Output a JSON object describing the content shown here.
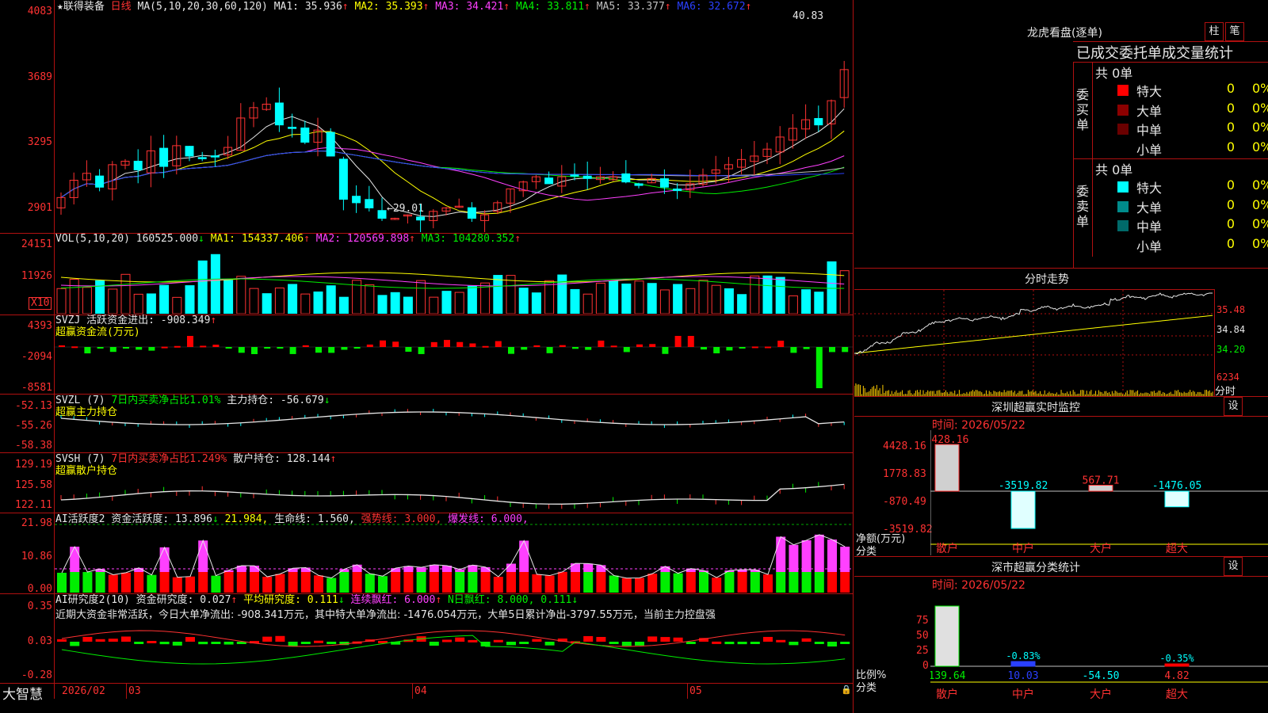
{
  "main": {
    "stock_name": "★联得装备",
    "period": "日线",
    "ma_header": "MA(5,10,20,30,60,120)",
    "ma_values": [
      {
        "label": "MA1:",
        "value": "35.936",
        "arrow": "↑",
        "color": "#e6e6e6"
      },
      {
        "label": "MA2:",
        "value": "35.393",
        "arrow": "↑",
        "color": "#ffff00"
      },
      {
        "label": "MA3:",
        "value": "34.421",
        "arrow": "↑",
        "color": "#ff40ff"
      },
      {
        "label": "MA4:",
        "value": "33.811",
        "arrow": "↑",
        "color": "#00ee00"
      },
      {
        "label": "MA5:",
        "value": "33.377",
        "arrow": "↑",
        "color": "#c0c0c0"
      },
      {
        "label": "MA6:",
        "value": "32.672",
        "arrow": "↑",
        "color": "#2a40ff"
      }
    ],
    "y_ticks": [
      "4083",
      "3689",
      "3295",
      "2901"
    ],
    "high_label": "40.83",
    "low_label": "←29.01"
  },
  "vol": {
    "header": "VOL(5,10,20)",
    "value": "160525.000",
    "value_arrow": "↓",
    "ma": [
      {
        "label": "MA1:",
        "value": "154337.406",
        "arrow": "↑",
        "color": "#ffff00"
      },
      {
        "label": "MA2:",
        "value": "120569.898",
        "arrow": "↑",
        "color": "#ff40ff"
      },
      {
        "label": "MA3:",
        "value": "104280.352",
        "arrow": "↑",
        "color": "#00ee00"
      }
    ],
    "y_ticks": [
      "24151",
      "11926"
    ],
    "unit": "X10"
  },
  "svzj": {
    "header": "SVZJ",
    "label": "活跃资金进出:",
    "value": "-908.349",
    "arrow": "↑",
    "subtitle": "超赢资金流(万元)",
    "y_ticks": [
      "4393",
      "-2094",
      "-8581"
    ]
  },
  "svzl": {
    "header": "SVZL (7)",
    "ratio": "7日内买卖净占比1.01%",
    "label": "主力持仓:",
    "value": "-56.679",
    "arrow": "↓",
    "subtitle": "超赢主力持仓",
    "y_ticks": [
      "-52.13",
      "-55.26",
      "-58.38"
    ]
  },
  "svsh": {
    "header": "SVSH (7)",
    "ratio": "7日内买卖净占比1.249%",
    "label": "散户持仓:",
    "value": "128.144",
    "arrow": "↑",
    "subtitle": "超赢散户持仓",
    "y_ticks": [
      "129.19",
      "125.58",
      "122.11"
    ]
  },
  "ai1": {
    "header": "AI活跃度2",
    "label": "资金活跃度:",
    "value": "13.896",
    "arrow": "↓",
    "v2": "21.984,",
    "life_label": "生命线:",
    "life_value": "1.560,",
    "strong": "强势线: 3.000,",
    "burst": "爆发线: 6.000,",
    "y_ticks": [
      "21.98",
      "10.86",
      "0.00"
    ]
  },
  "ai2": {
    "header": "AI研究度2(10)",
    "label": "资金研究度:",
    "value": "0.027",
    "arrow": "↑",
    "avg": "平均研究度: 0.111",
    "avg_arrow": "↓",
    "streak": "连续飘红: 6.000",
    "streak_arrow": "↑",
    "nday": "N日飘红: 8.000, 0.111",
    "nday_arrow": "↓",
    "commentary": "近期大资金非常活跃，今日大单净流出: -908.341万元，其中特大单净流出: -1476.054万元，大单5日累计净出-3797.55万元，当前主力控盘强",
    "y_ticks": [
      "0.35",
      "0.03",
      "-0.28"
    ]
  },
  "xaxis": {
    "brand": "大智慧",
    "labels": [
      "2026/02",
      "03",
      "04",
      "05"
    ]
  },
  "lhb": {
    "title": "龙虎看盘(逐单)",
    "btn_col": "柱",
    "btn_tick": "笔",
    "tabs": [
      "已成交",
      "委托单",
      "成交量统计"
    ],
    "buy": {
      "side": "委买单",
      "total": "共 0单",
      "rows": [
        {
          "label": "特大",
          "count": "0",
          "pct": "0%",
          "color": "#ff0000"
        },
        {
          "label": "大单",
          "count": "0",
          "pct": "0%",
          "color": "#8b0000"
        },
        {
          "label": "中单",
          "count": "0",
          "pct": "0%",
          "color": "#6a0000"
        },
        {
          "label": "小单",
          "count": "0",
          "pct": "0%",
          "color": "#000000"
        }
      ]
    },
    "sell": {
      "side": "委卖单",
      "total": "共 0单",
      "rows": [
        {
          "label": "特大",
          "count": "0",
          "pct": "0%",
          "color": "#00ffff"
        },
        {
          "label": "大单",
          "count": "0",
          "pct": "0%",
          "color": "#008b8b"
        },
        {
          "label": "中单",
          "count": "0",
          "pct": "0%",
          "color": "#006a6a"
        },
        {
          "label": "小单",
          "count": "0",
          "pct": "0%",
          "color": "#000000"
        }
      ]
    }
  },
  "intraday": {
    "title": "分时走势",
    "prices": [
      "35.48",
      "34.84",
      "34.20"
    ],
    "vol_tick": "6234",
    "vol_label": "分时"
  },
  "sz_monitor": {
    "title": "深圳超赢实时监控",
    "btn": "设",
    "time": "时间: 2026/05/22",
    "y_ticks": [
      "4428.16",
      "1778.83",
      "-870.49",
      "-3519.82"
    ],
    "axis_label": "净额(万元)",
    "axis_sub": "分类",
    "categories": [
      "散户",
      "中户",
      "大户",
      "超大"
    ],
    "values": [
      4428.16,
      -3519.82,
      567.71,
      -1476.05
    ],
    "value_labels": [
      "4428.16",
      "-3519.82",
      "567.71",
      "-1476.05"
    ]
  },
  "sz_class": {
    "title": "深市超赢分类统计",
    "btn": "设",
    "time": "时间: 2026/05/22",
    "y_ticks": [
      "75",
      "50",
      "25",
      "0"
    ],
    "axis_label": "比例%",
    "axis_sub": "分类",
    "categories": [
      "散户",
      "中户",
      "大户",
      "超大"
    ],
    "bottom_values": [
      "139.64",
      "10.03",
      "-54.50",
      "4.82"
    ],
    "top_labels": [
      "",
      "-0.83%",
      "",
      "-0.35%"
    ]
  }
}
